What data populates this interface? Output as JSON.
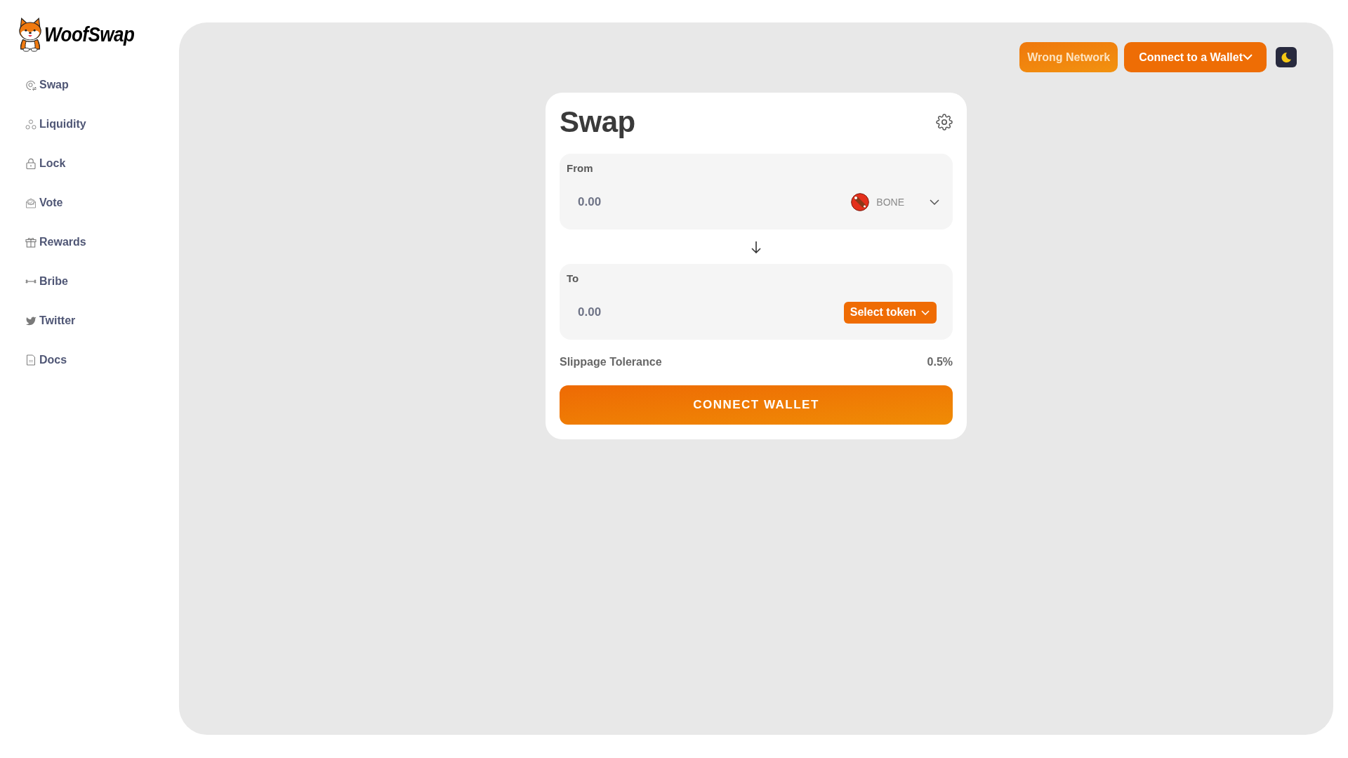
{
  "logo": {
    "text": "WoofSwap"
  },
  "sidebar": {
    "items": [
      {
        "label": "Swap"
      },
      {
        "label": "Liquidity"
      },
      {
        "label": "Lock"
      },
      {
        "label": "Vote"
      },
      {
        "label": "Rewards"
      },
      {
        "label": "Bribe"
      },
      {
        "label": "Twitter"
      },
      {
        "label": "Docs"
      }
    ]
  },
  "header": {
    "buttons": [
      {
        "label": "Wrong Network",
        "kind": "warning"
      },
      {
        "label": "Connect to a Wallet",
        "kind": "dropdown"
      }
    ]
  },
  "swap_card": {
    "title": "Swap",
    "panels": [
      {
        "kind": "token",
        "label": "From",
        "placeholder": "0.00",
        "token": "BONE"
      },
      {
        "kind": "select",
        "label": "To",
        "placeholder": "0.00",
        "select_label": "Select token"
      }
    ],
    "slippage": {
      "label": "Slippage Tolerance",
      "value": "0.5%"
    },
    "action_button": "CONNECT WALLET"
  }
}
